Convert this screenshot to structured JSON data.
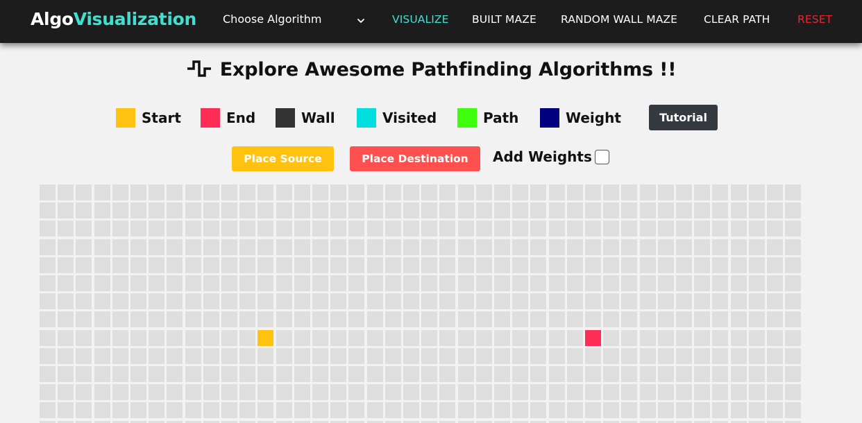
{
  "navbar": {
    "brand_part1": "Algo",
    "brand_part2": "Visualization",
    "algorithm_select": {
      "value": "Choose Algorithm",
      "icon": "chevron-down-icon"
    },
    "links": [
      {
        "label": "VISUALIZE",
        "color": "#40e0d0"
      },
      {
        "label": "BUILT MAZE",
        "color": "#ffffff"
      },
      {
        "label": "RANDOM WALL MAZE",
        "color": "#ffffff"
      },
      {
        "label": "CLEAR PATH",
        "color": "#ffffff"
      },
      {
        "label": "RESET",
        "color": "#e8252d"
      }
    ]
  },
  "heading": {
    "icon": "square-wave-icon",
    "text": "Explore Awesome Pathfinding Algorithms !!"
  },
  "legend": [
    {
      "label": "Start",
      "color": "#ffc20e"
    },
    {
      "label": "End",
      "color": "#ff2d55"
    },
    {
      "label": "Wall",
      "color": "#333333"
    },
    {
      "label": "Visited",
      "color": "#00dfdf"
    },
    {
      "label": "Path",
      "color": "#3dff0e"
    },
    {
      "label": "Weight",
      "color": "#000080"
    }
  ],
  "tutorial_label": "Tutorial",
  "controls": {
    "place_source": {
      "label": "Place Source",
      "color": "#ffc20e"
    },
    "place_destination": {
      "label": "Place Destination",
      "color": "#ff5050"
    },
    "add_weights": {
      "label": "Add Weights",
      "checked": false
    }
  },
  "grid": {
    "columns": 42,
    "visible_rows": 14,
    "cell_color": "#dedede",
    "start_cell": {
      "row": 8,
      "col": 12,
      "color": "#ffc20e"
    },
    "end_cell": {
      "row": 8,
      "col": 30,
      "color": "#ff2d55"
    }
  }
}
